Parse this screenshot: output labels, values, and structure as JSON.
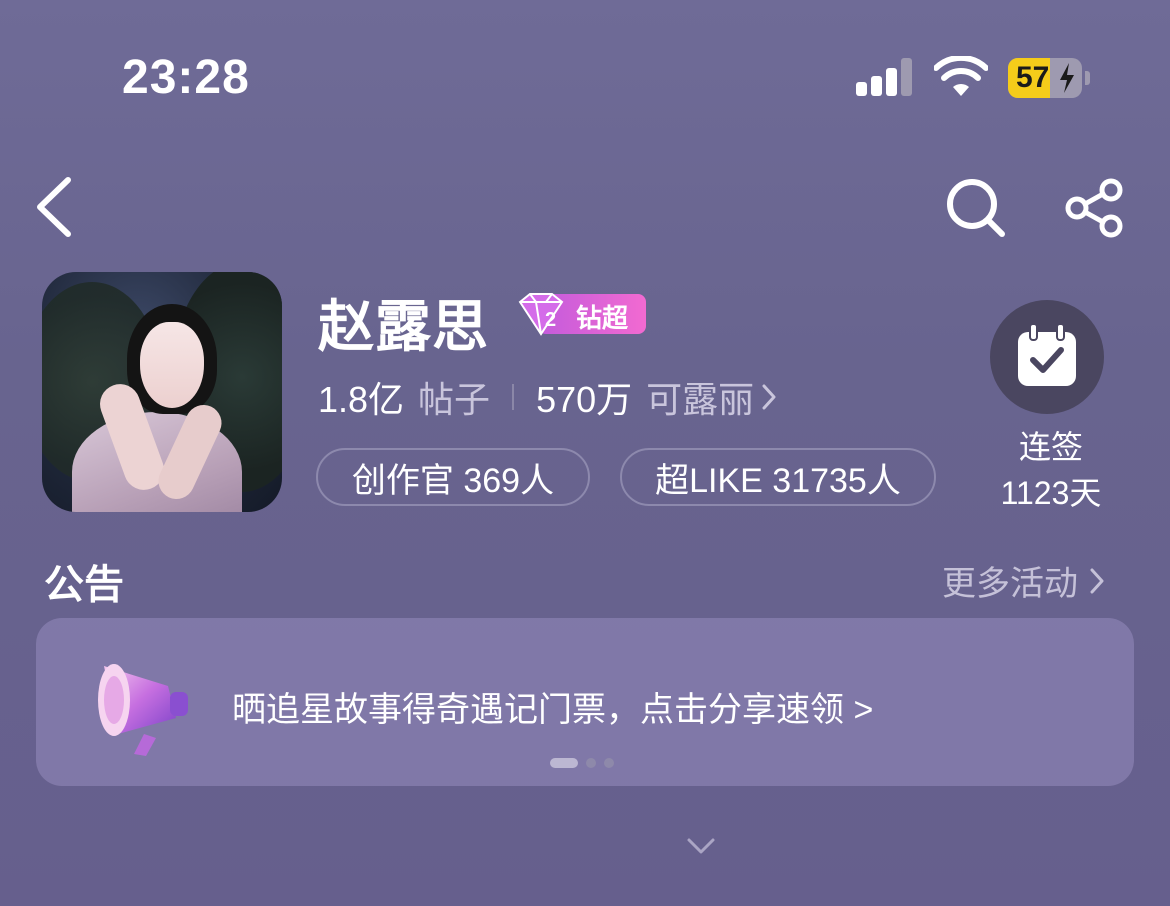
{
  "status_bar": {
    "time": "23:28",
    "battery_percent": "57",
    "battery_level": 0.57,
    "signal_bars_filled": 3,
    "signal_bars_total": 4
  },
  "nav": {
    "back_icon": "chevron-left-icon",
    "search_icon": "search-icon",
    "share_icon": "share-icon"
  },
  "profile": {
    "name": "赵露思",
    "badge_label": "钻超",
    "badge_level": "2",
    "posts_count": "1.8亿",
    "posts_label": "帖子",
    "fans_count": "570万",
    "fans_label": "可露丽",
    "creators_chip": "创作官 369人",
    "superlike_chip": "超LIKE 31735人"
  },
  "checkin": {
    "label": "连签",
    "days": "1123天"
  },
  "announcement": {
    "title": "公告",
    "more_label": "更多活动",
    "text": "晒追星故事得奇遇记门票，点击分享速领 >",
    "carousel_pages": 3,
    "carousel_active": 1
  },
  "colors": {
    "background": "#6b6793",
    "badge_gradient_start": "#c35bdc",
    "badge_gradient_end": "#f26ad1",
    "battery_fill": "#f5cc1a"
  }
}
